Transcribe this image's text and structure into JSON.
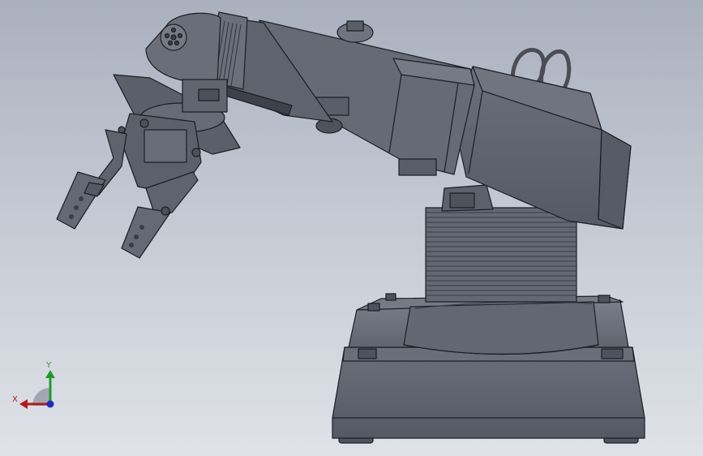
{
  "viewport": {
    "background_top": "#a9b0be",
    "background_bottom": "#dfe2e8",
    "model_color": "#5e626d",
    "edge_color": "#1c1e24"
  },
  "triad": {
    "x_label": "X",
    "y_label": "Y",
    "x_color": "#b01c1c",
    "y_color": "#1f9a2a",
    "z_color": "#1b2fbf"
  }
}
